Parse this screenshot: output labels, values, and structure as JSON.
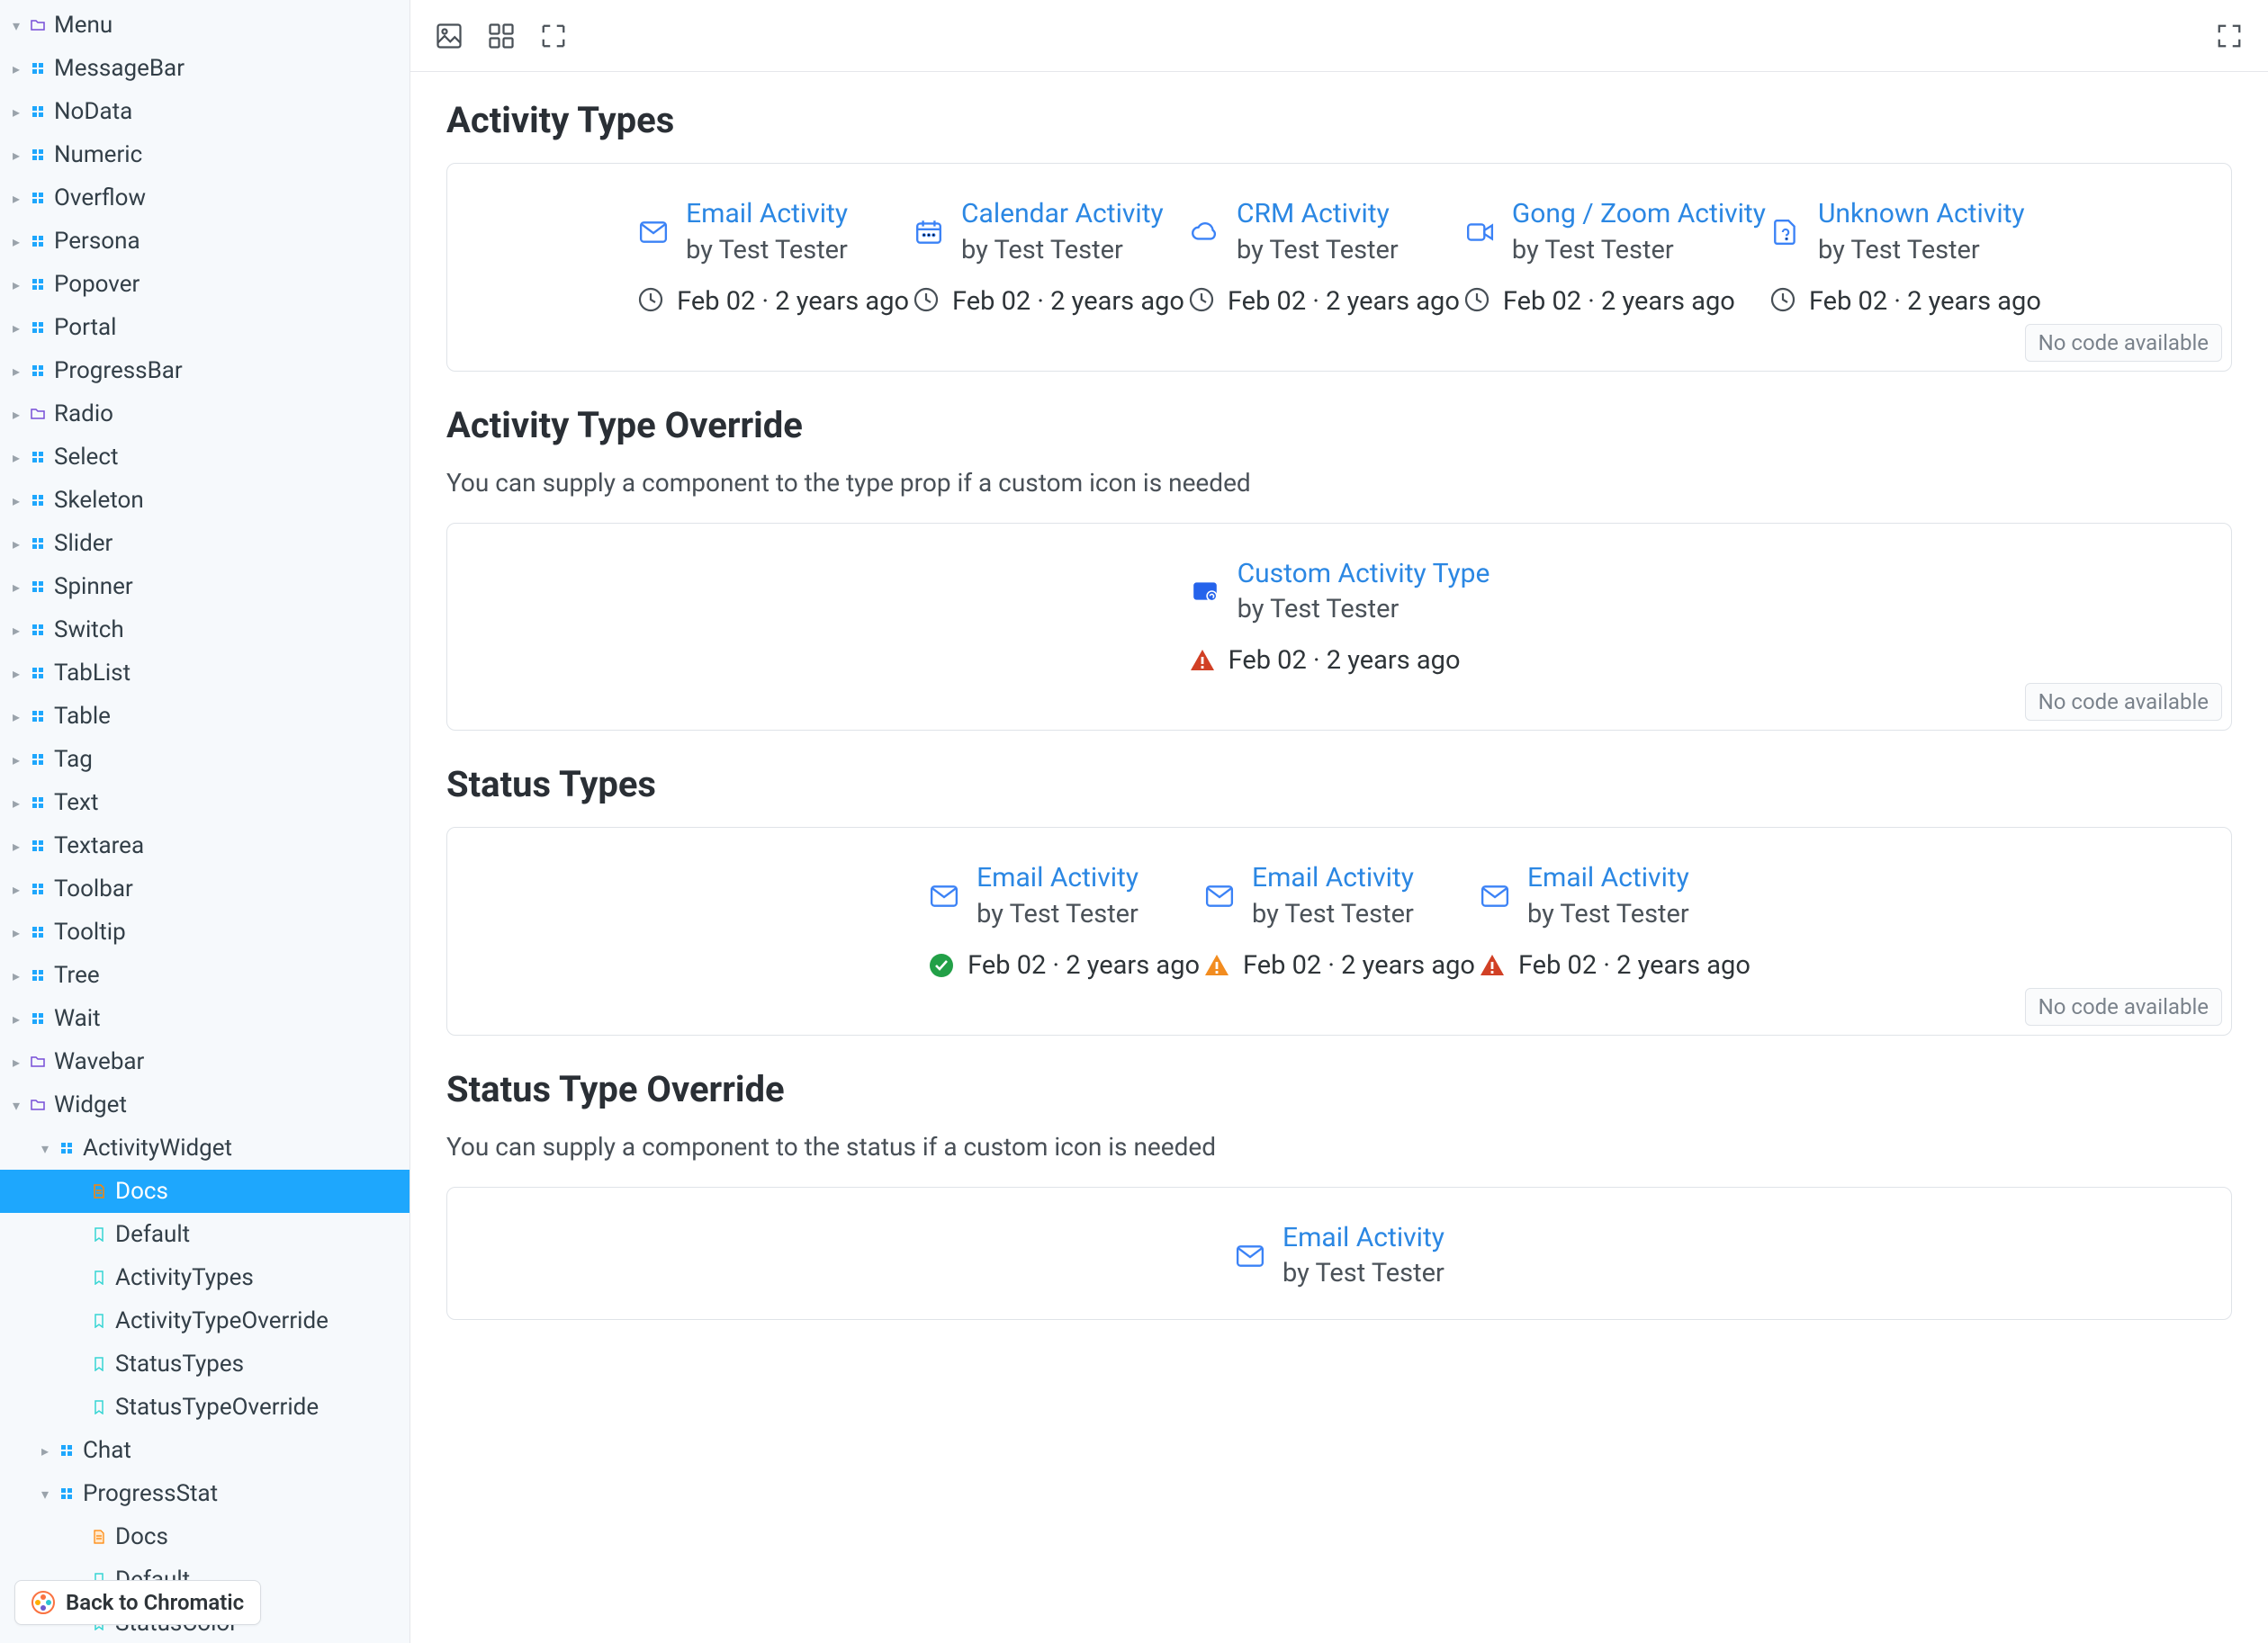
{
  "sidebar": {
    "back_label": "Back to Chromatic",
    "items": [
      {
        "label": "Menu",
        "icon": "folder",
        "depth": 0,
        "caret": "down",
        "selected": false
      },
      {
        "label": "MessageBar",
        "icon": "component",
        "depth": 0,
        "caret": "right",
        "selected": false
      },
      {
        "label": "NoData",
        "icon": "component",
        "depth": 0,
        "caret": "right",
        "selected": false
      },
      {
        "label": "Numeric",
        "icon": "component",
        "depth": 0,
        "caret": "right",
        "selected": false
      },
      {
        "label": "Overflow",
        "icon": "component",
        "depth": 0,
        "caret": "right",
        "selected": false
      },
      {
        "label": "Persona",
        "icon": "component",
        "depth": 0,
        "caret": "right",
        "selected": false
      },
      {
        "label": "Popover",
        "icon": "component",
        "depth": 0,
        "caret": "right",
        "selected": false
      },
      {
        "label": "Portal",
        "icon": "component",
        "depth": 0,
        "caret": "right",
        "selected": false
      },
      {
        "label": "ProgressBar",
        "icon": "component",
        "depth": 0,
        "caret": "right",
        "selected": false
      },
      {
        "label": "Radio",
        "icon": "folder",
        "depth": 0,
        "caret": "right",
        "selected": false
      },
      {
        "label": "Select",
        "icon": "component",
        "depth": 0,
        "caret": "right",
        "selected": false
      },
      {
        "label": "Skeleton",
        "icon": "component",
        "depth": 0,
        "caret": "right",
        "selected": false
      },
      {
        "label": "Slider",
        "icon": "component",
        "depth": 0,
        "caret": "right",
        "selected": false
      },
      {
        "label": "Spinner",
        "icon": "component",
        "depth": 0,
        "caret": "right",
        "selected": false
      },
      {
        "label": "Switch",
        "icon": "component",
        "depth": 0,
        "caret": "right",
        "selected": false
      },
      {
        "label": "TabList",
        "icon": "component",
        "depth": 0,
        "caret": "right",
        "selected": false
      },
      {
        "label": "Table",
        "icon": "component",
        "depth": 0,
        "caret": "right",
        "selected": false
      },
      {
        "label": "Tag",
        "icon": "component",
        "depth": 0,
        "caret": "right",
        "selected": false
      },
      {
        "label": "Text",
        "icon": "component",
        "depth": 0,
        "caret": "right",
        "selected": false
      },
      {
        "label": "Textarea",
        "icon": "component",
        "depth": 0,
        "caret": "right",
        "selected": false
      },
      {
        "label": "Toolbar",
        "icon": "component",
        "depth": 0,
        "caret": "right",
        "selected": false
      },
      {
        "label": "Tooltip",
        "icon": "component",
        "depth": 0,
        "caret": "right",
        "selected": false
      },
      {
        "label": "Tree",
        "icon": "component",
        "depth": 0,
        "caret": "right",
        "selected": false
      },
      {
        "label": "Wait",
        "icon": "component",
        "depth": 0,
        "caret": "right",
        "selected": false
      },
      {
        "label": "Wavebar",
        "icon": "folder",
        "depth": 0,
        "caret": "right",
        "selected": false
      },
      {
        "label": "Widget",
        "icon": "folder",
        "depth": 0,
        "caret": "down",
        "selected": false
      },
      {
        "label": "ActivityWidget",
        "icon": "component",
        "depth": 1,
        "caret": "down",
        "selected": false
      },
      {
        "label": "Docs",
        "icon": "doc",
        "depth": 2,
        "caret": "none",
        "selected": true
      },
      {
        "label": "Default",
        "icon": "story",
        "depth": 2,
        "caret": "none",
        "selected": false
      },
      {
        "label": "ActivityTypes",
        "icon": "story",
        "depth": 2,
        "caret": "none",
        "selected": false
      },
      {
        "label": "ActivityTypeOverride",
        "icon": "story",
        "depth": 2,
        "caret": "none",
        "selected": false
      },
      {
        "label": "StatusTypes",
        "icon": "story",
        "depth": 2,
        "caret": "none",
        "selected": false
      },
      {
        "label": "StatusTypeOverride",
        "icon": "story",
        "depth": 2,
        "caret": "none",
        "selected": false
      },
      {
        "label": "Chat",
        "icon": "component",
        "depth": 1,
        "caret": "right",
        "selected": false
      },
      {
        "label": "ProgressStat",
        "icon": "component",
        "depth": 1,
        "caret": "down",
        "selected": false
      },
      {
        "label": "Docs",
        "icon": "doc-orange",
        "depth": 2,
        "caret": "none",
        "selected": false
      },
      {
        "label": "Default",
        "icon": "story",
        "depth": 2,
        "caret": "none",
        "selected": false
      },
      {
        "label": "StatusColor",
        "icon": "story",
        "depth": 2,
        "caret": "none",
        "selected": false
      }
    ]
  },
  "sections": {
    "activity_types": {
      "title": "Activity Types",
      "no_code": "No code available",
      "items": [
        {
          "title": "Email Activity",
          "sub": "by Test Tester",
          "date": "Feb 02 · 2 years ago",
          "icon": "mail"
        },
        {
          "title": "Calendar Activity",
          "sub": "by Test Tester",
          "date": "Feb 02 · 2 years ago",
          "icon": "calendar"
        },
        {
          "title": "CRM Activity",
          "sub": "by Test Tester",
          "date": "Feb 02 · 2 years ago",
          "icon": "cloud"
        },
        {
          "title": "Gong / Zoom Activity",
          "sub": "by Test Tester",
          "date": "Feb 02 · 2 years ago",
          "icon": "video"
        },
        {
          "title": "Unknown Activity",
          "sub": "by Test Tester",
          "date": "Feb 02 · 2 years ago",
          "icon": "file-question"
        }
      ]
    },
    "activity_override": {
      "title": "Activity Type Override",
      "desc": "You can supply a component to the type prop if a custom icon is needed",
      "no_code": "No code available",
      "item": {
        "title": "Custom Activity Type",
        "sub": "by Test Tester",
        "date": "Feb 02 · 2 years ago",
        "icon": "custom",
        "status": "error-red"
      }
    },
    "status_types": {
      "title": "Status Types",
      "no_code": "No code available",
      "items": [
        {
          "title": "Email Activity",
          "sub": "by Test Tester",
          "date": "Feb 02 · 2 years ago",
          "icon": "mail",
          "status": "success"
        },
        {
          "title": "Email Activity",
          "sub": "by Test Tester",
          "date": "Feb 02 · 2 years ago",
          "icon": "mail",
          "status": "warning"
        },
        {
          "title": "Email Activity",
          "sub": "by Test Tester",
          "date": "Feb 02 · 2 years ago",
          "icon": "mail",
          "status": "error-red"
        }
      ]
    },
    "status_override": {
      "title": "Status Type Override",
      "desc": "You can supply a component to the status if a custom icon is needed",
      "item": {
        "title": "Email Activity",
        "sub": "by Test Tester",
        "icon": "mail"
      }
    }
  }
}
